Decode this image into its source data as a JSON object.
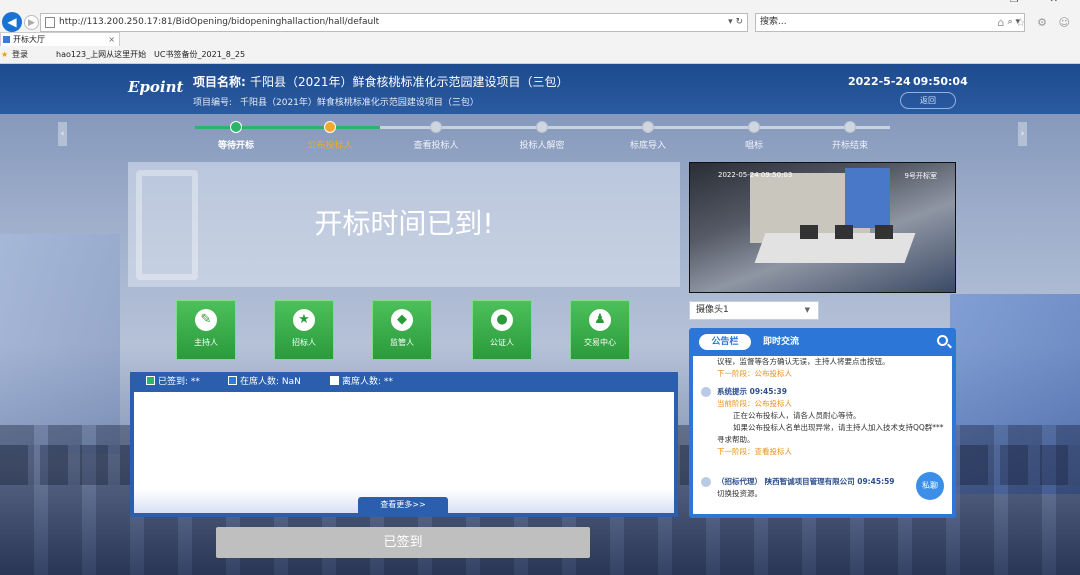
{
  "browser": {
    "url": "http://113.200.250.17:81/BidOpening/bidopeninghallaction/hall/default",
    "addr_tools": "▾ ↻",
    "search_placeholder": "搜索...",
    "search_tools": "⌕ ▾",
    "tab_title": "开标大厅",
    "tab_close": "×",
    "favorites": [
      "登录",
      "hao123_上网从这里开始",
      "UC书签备份_2021_8_25"
    ],
    "chrome_icons": "⌂ ☆ ⚙ ☺",
    "window_controls": "– ❐ ✕"
  },
  "header": {
    "logo": "Epoint",
    "project_name_label": "项目名称:",
    "project_name": "千阳县（2021年）鲜食核桃标准化示范园建设项目（三包）",
    "project_no_label": "项目编号:",
    "project_no": "千阳县（2021年）鲜食核桃标准化示范园建设项目（三包）",
    "date": "2022-5-24",
    "time": "09:50:04",
    "button": "返回"
  },
  "steps": [
    {
      "label": "等待开标",
      "state": "done"
    },
    {
      "label": "公布投标人",
      "state": "current"
    },
    {
      "label": "查看投标人",
      "state": "todo"
    },
    {
      "label": "投标人解密",
      "state": "todo"
    },
    {
      "label": "标底导入",
      "state": "todo"
    },
    {
      "label": "唱标",
      "state": "todo"
    },
    {
      "label": "开标结束",
      "state": "todo"
    }
  ],
  "banner": {
    "title": "开标时间已到!"
  },
  "roles": [
    {
      "label": "主持人",
      "icon": "host-icon",
      "glyph": "✎"
    },
    {
      "label": "招标人",
      "icon": "tenderer-icon",
      "glyph": "★"
    },
    {
      "label": "监管人",
      "icon": "supervisor-icon",
      "glyph": "◆"
    },
    {
      "label": "公证人",
      "icon": "notary-icon",
      "glyph": "●"
    },
    {
      "label": "交易中心",
      "icon": "trading-center-icon",
      "glyph": "♟"
    }
  ],
  "signin": {
    "signed": "已签到: **",
    "present": "在席人数: NaN",
    "absent": "离席人数: **",
    "see_more": "查看更多>>",
    "button": "已签到"
  },
  "video": {
    "timestamp": "2022-05-24 09:50:03",
    "camera_name": "9号开标室",
    "nav_left": "‹",
    "nav_right": "›"
  },
  "camera_select": {
    "value": "摄像头1",
    "caret": "▼"
  },
  "notice": {
    "tab_active": "公告栏",
    "tab_other": "即时交流",
    "entries": [
      {
        "line1": "议程，监督等各方确认无误，主持人将要点击按钮。",
        "line2": "下一阶段：公布投标人"
      },
      {
        "who": "系统提示 09:45:39",
        "stage": "当前阶段：公布投标人",
        "line1": "正在公布投标人，请各人员耐心等待。",
        "line2": "如果公布投标人名单出现异常，请主持人加入技术支持QQ群***",
        "line3": "寻求帮助。",
        "next": "下一阶段：查看投标人"
      },
      {
        "who": "（招标代理） 陕西智诚项目管理有限公司 09:45:59",
        "line1": "切换投资源。"
      }
    ],
    "private_chat": "私聊"
  }
}
